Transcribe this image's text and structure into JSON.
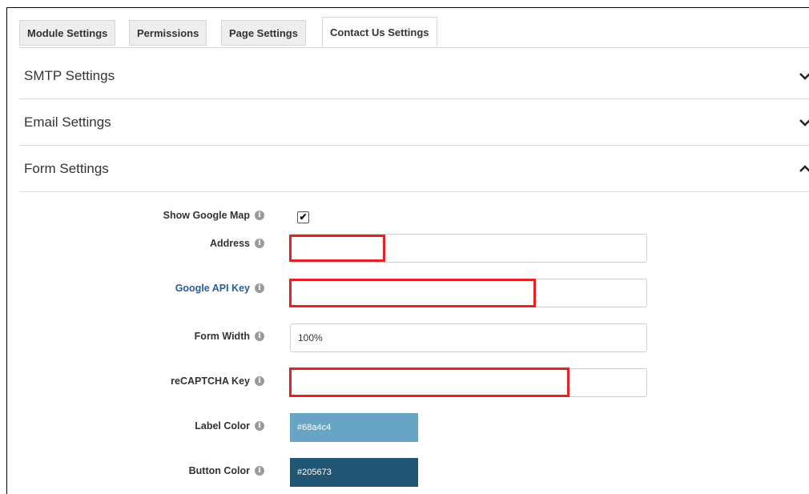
{
  "tabs": [
    {
      "label": "Module Settings"
    },
    {
      "label": "Permissions"
    },
    {
      "label": "Page Settings"
    },
    {
      "label": "Contact Us Settings",
      "active": true
    }
  ],
  "sections": [
    {
      "title": "SMTP Settings",
      "expanded": false
    },
    {
      "title": "Email Settings",
      "expanded": false
    },
    {
      "title": "Form Settings",
      "expanded": true
    }
  ],
  "form": {
    "show_google_map": {
      "label": "Show Google Map",
      "checked": true,
      "check_glyph": "✔"
    },
    "address": {
      "label": "Address",
      "value": ""
    },
    "google_api_key": {
      "label": "Google API Key",
      "value": ""
    },
    "form_width": {
      "label": "Form Width",
      "value": "100%"
    },
    "recaptcha_key": {
      "label": "reCAPTCHA Key",
      "value": ""
    },
    "label_color": {
      "label": "Label Color",
      "value": "#68a4c4"
    },
    "button_color": {
      "label": "Button Color",
      "value": "#205673"
    }
  },
  "icons": {
    "info": "i",
    "info_name": "info-icon",
    "chevron": "chevron-icon"
  },
  "colors": {
    "highlight_red": "#e32226",
    "link_blue": "#2a5d9e"
  }
}
